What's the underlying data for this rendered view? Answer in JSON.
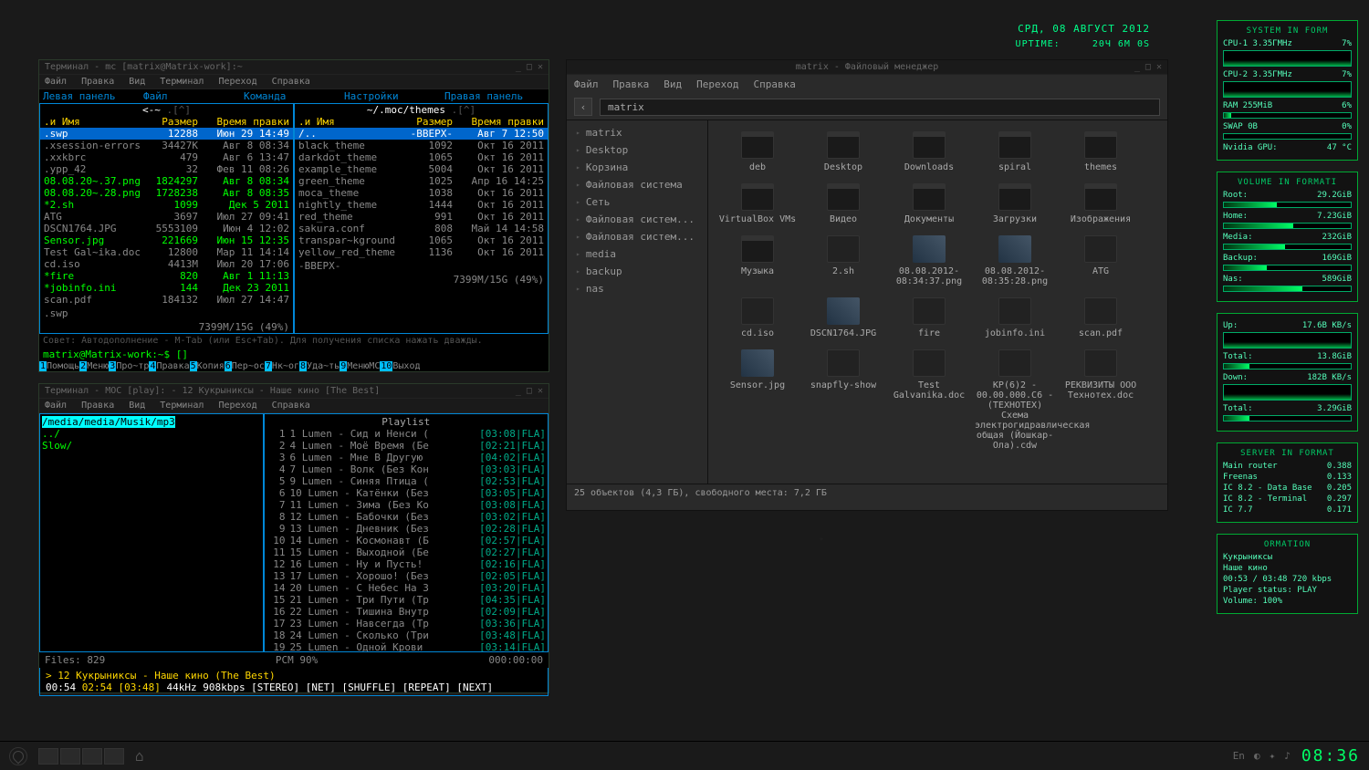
{
  "top_date": "СРД, 08 АВГУСТ 2012",
  "uptime_label": "UPTIME:",
  "uptime_value": "20Ч 6M 0S",
  "mc": {
    "title": "Терминал - mc [matrix@Matrix-work]:~",
    "menu": [
      "Файл",
      "Правка",
      "Вид",
      "Терминал",
      "Переход",
      "Справка"
    ],
    "head": [
      "Левая панель",
      "Файл",
      "Команда",
      "Настройки",
      "Правая панель"
    ],
    "left_title": "<-~",
    "right_title": "~/.moc/themes",
    "cols": {
      "name": ".и  Имя",
      "size": "Размер",
      "date": "Время правки"
    },
    "left_rows": [
      {
        "n": ".swp",
        "s": "12288",
        "d": "Июн 29 14:49",
        "cls": "sel"
      },
      {
        "n": ".xsession-errors",
        "s": "34427K",
        "d": "Авг  8 08:34",
        "cls": ""
      },
      {
        "n": ".xxkbrc",
        "s": "479",
        "d": "Авг  6 13:47",
        "cls": ""
      },
      {
        "n": ".ypp_42",
        "s": "32",
        "d": "Фев 11 08:26",
        "cls": ""
      },
      {
        "n": "08.08.20~.37.png",
        "s": "1824297",
        "d": "Авг  8 08:34",
        "cls": "exec"
      },
      {
        "n": "08.08.20~.28.png",
        "s": "1728238",
        "d": "Авг  8 08:35",
        "cls": "exec"
      },
      {
        "n": "*2.sh",
        "s": "1099",
        "d": "Дек  5  2011",
        "cls": "exec"
      },
      {
        "n": "ATG",
        "s": "3697",
        "d": "Июл 27 09:41",
        "cls": ""
      },
      {
        "n": "DSCN1764.JPG",
        "s": "5553109",
        "d": "Июн  4 12:02",
        "cls": ""
      },
      {
        "n": "Sensor.jpg",
        "s": "221669",
        "d": "Июн 15 12:35",
        "cls": "exec"
      },
      {
        "n": "Test Gal~ika.doc",
        "s": "12800",
        "d": "Мар 11 14:14",
        "cls": ""
      },
      {
        "n": "cd.iso",
        "s": "4413M",
        "d": "Июл 20 17:06",
        "cls": ""
      },
      {
        "n": "*fire",
        "s": "820",
        "d": "Авг  1 11:13",
        "cls": "exec"
      },
      {
        "n": "*jobinfo.ini",
        "s": "144",
        "d": "Дек 23  2011",
        "cls": "exec"
      },
      {
        "n": "scan.pdf",
        "s": "184132",
        "d": "Июл 27 14:47",
        "cls": ""
      }
    ],
    "right_rows": [
      {
        "n": "/..",
        "s": "-ВВЕРХ-",
        "d": "Авг  7 12:50",
        "cls": "sel"
      },
      {
        "n": "black_theme",
        "s": "1092",
        "d": "Окт 16  2011",
        "cls": ""
      },
      {
        "n": "darkdot_theme",
        "s": "1065",
        "d": "Окт 16  2011",
        "cls": ""
      },
      {
        "n": "example_theme",
        "s": "5004",
        "d": "Окт 16  2011",
        "cls": ""
      },
      {
        "n": "green_theme",
        "s": "1025",
        "d": "Апр 16 14:25",
        "cls": ""
      },
      {
        "n": "moca_theme",
        "s": "1038",
        "d": "Окт 16  2011",
        "cls": ""
      },
      {
        "n": "nightly_theme",
        "s": "1444",
        "d": "Окт 16  2011",
        "cls": ""
      },
      {
        "n": "red_theme",
        "s": "991",
        "d": "Окт 16  2011",
        "cls": ""
      },
      {
        "n": "sakura.conf",
        "s": "808",
        "d": "Май 14 14:58",
        "cls": ""
      },
      {
        "n": "transpar~kground",
        "s": "1065",
        "d": "Окт 16  2011",
        "cls": ""
      },
      {
        "n": "yellow_red_theme",
        "s": "1136",
        "d": "Окт 16  2011",
        "cls": ""
      }
    ],
    "left_sel": ".swp",
    "right_sel": "-ВВЕРХ-",
    "disk": "7399M/15G (49%)",
    "hint": "Совет: Автодополнение - M-Tab (или Esc+Tab). Для получения списка нажать дважды.",
    "prompt": "matrix@Matrix-work:~$ []",
    "fkeys": [
      {
        "k": "1",
        "l": "Помощь"
      },
      {
        "k": "2",
        "l": "Меню"
      },
      {
        "k": "3",
        "l": "Про~тр"
      },
      {
        "k": "4",
        "l": "Правка"
      },
      {
        "k": "5",
        "l": "Копия"
      },
      {
        "k": "6",
        "l": "Пер~ос"
      },
      {
        "k": "7",
        "l": "Нк~ог"
      },
      {
        "k": "8",
        "l": "Уда~ть"
      },
      {
        "k": "9",
        "l": "МенюМС"
      },
      {
        "k": "10",
        "l": "Выход"
      }
    ]
  },
  "moc": {
    "title": "Терминал - MOC [play]: - 12 Кукрыниксы - Наше кино [The Best]",
    "menu": [
      "Файл",
      "Правка",
      "Вид",
      "Терминал",
      "Переход",
      "Справка"
    ],
    "path": "/media/media/Musik/mp3",
    "dirs": [
      "../",
      "Slow/"
    ],
    "playlist_title": "Playlist",
    "tracks": [
      {
        "i": "1",
        "n": "1 Lumen - Сид и Ненси (",
        "d": "[03:08|FLA]"
      },
      {
        "i": "2",
        "n": "4 Lumen - Моё Время (Бе",
        "d": "[02:21|FLA]"
      },
      {
        "i": "3",
        "n": "6 Lumen - Мне В Другую ",
        "d": "[04:02|FLA]"
      },
      {
        "i": "4",
        "n": "7 Lumen - Волк (Без Кон",
        "d": "[03:03|FLA]"
      },
      {
        "i": "5",
        "n": "9 Lumen - Синяя Птица (",
        "d": "[02:53|FLA]"
      },
      {
        "i": "6",
        "n": "10 Lumen - Катёнки (Без",
        "d": "[03:05|FLA]"
      },
      {
        "i": "7",
        "n": "11 Lumen - Зима (Без Ко",
        "d": "[03:08|FLA]"
      },
      {
        "i": "8",
        "n": "12 Lumen - Бабочки (Без",
        "d": "[03:02|FLA]"
      },
      {
        "i": "9",
        "n": "13 Lumen - Дневник (Без",
        "d": "[02:28|FLA]"
      },
      {
        "i": "10",
        "n": "14 Lumen - Космонавт (Б",
        "d": "[02:57|FLA]"
      },
      {
        "i": "11",
        "n": "15 Lumen - Выходной (Бе",
        "d": "[02:27|FLA]"
      },
      {
        "i": "12",
        "n": "16 Lumen - Ну и Пусть! ",
        "d": "[02:16|FLA]"
      },
      {
        "i": "13",
        "n": "17 Lumen - Хорошо! (Без",
        "d": "[02:05|FLA]"
      },
      {
        "i": "14",
        "n": "20 Lumen - С Небес На З",
        "d": "[03:20|FLA]"
      },
      {
        "i": "15",
        "n": "21 Lumen - Три Пути (Тр",
        "d": "[04:35|FLA]"
      },
      {
        "i": "16",
        "n": "22 Lumen - Тишина Внутр",
        "d": "[02:09|FLA]"
      },
      {
        "i": "17",
        "n": "23 Lumen - Навсегда (Тр",
        "d": "[03:36|FLA]"
      },
      {
        "i": "18",
        "n": "24 Lumen - Сколько (Три",
        "d": "[03:48|FLA]"
      },
      {
        "i": "19",
        "n": "25 Lumen - Одной Крови ",
        "d": "[03:14|FLA]"
      }
    ],
    "files": "Files: 829",
    "pcm": "PCM   90%",
    "total": "000:00:00",
    "playing": "> 12 Кукрыниксы - Наше кино (The Best)",
    "time": "00:54",
    "elapsed": "02:54 [03:48]",
    "info": "  44kHz  908kbps [STEREO] [NET] [SHUFFLE] [REPEAT] [NEXT]"
  },
  "thunar": {
    "title": "matrix - Файловый менеджер",
    "menu": [
      "Файл",
      "Правка",
      "Вид",
      "Переход",
      "Справка"
    ],
    "path": "matrix",
    "side": [
      "matrix",
      "Desktop",
      "Корзина",
      "Файловая система",
      "Сеть",
      "Файловая систем...",
      "Файловая систем...",
      "media",
      "backup",
      "nas"
    ],
    "icons": [
      {
        "n": "deb",
        "t": "folder"
      },
      {
        "n": "Desktop",
        "t": "folder"
      },
      {
        "n": "Downloads",
        "t": "folder"
      },
      {
        "n": "spiral",
        "t": "folder"
      },
      {
        "n": "themes",
        "t": "folder"
      },
      {
        "n": "VirtualBox VMs",
        "t": "folder"
      },
      {
        "n": "Видео",
        "t": "folder"
      },
      {
        "n": "Документы",
        "t": "folder"
      },
      {
        "n": "Загрузки",
        "t": "folder"
      },
      {
        "n": "Изображения",
        "t": "folder"
      },
      {
        "n": "Музыка",
        "t": "folder"
      },
      {
        "n": "2.sh",
        "t": "file"
      },
      {
        "n": "08.08.2012-08:34:37.png",
        "t": "img"
      },
      {
        "n": "08.08.2012-08:35:28.png",
        "t": "img"
      },
      {
        "n": "ATG",
        "t": "file"
      },
      {
        "n": "cd.iso",
        "t": "file"
      },
      {
        "n": "DSCN1764.JPG",
        "t": "img"
      },
      {
        "n": "fire",
        "t": "file"
      },
      {
        "n": "jobinfo.ini",
        "t": "file"
      },
      {
        "n": "scan.pdf",
        "t": "file"
      },
      {
        "n": "Sensor.jpg",
        "t": "img"
      },
      {
        "n": "snapfly-show",
        "t": "file"
      },
      {
        "n": "Test Galvanika.doc",
        "t": "file"
      },
      {
        "n": "КР(6)2 - 00.00.000.С6 - (ТЕХНОТЕХ) Схема электрогидравлическая общая (Йошкар-Ола).cdw",
        "t": "file"
      },
      {
        "n": "РЕКВИЗИТЫ ООО Технотех.doc",
        "t": "file"
      }
    ],
    "status": "25 объектов (4,3 ГБ), свободного места: 7,2 ГБ"
  },
  "conky": {
    "sys_title": "SYSTEM IN FORM",
    "cpu1": {
      "l": "CPU-1 3.35ГMHz",
      "v": "7%"
    },
    "cpu2": {
      "l": "CPU-2 3.35ГMHz",
      "v": "7%"
    },
    "ram": {
      "l": "RAM 255MiB",
      "v": "6%"
    },
    "swap": {
      "l": "SWAP 0B",
      "v": "0%"
    },
    "gpu": {
      "l": "Nvidia GPU:",
      "v": "47 °C"
    },
    "vol_title": "VOLUME IN FORMATI",
    "vols": [
      {
        "l": "Root:",
        "v": "29.2GiB"
      },
      {
        "l": "Home:",
        "v": "7.23GiB"
      },
      {
        "l": "Media:",
        "v": "232GiB"
      },
      {
        "l": "Backup:",
        "v": "169GiB"
      },
      {
        "l": "Nas:",
        "v": "589GiB"
      }
    ],
    "net_rows": [
      {
        "l": "Up:",
        "v": "17.6B  KB/s"
      },
      {
        "l": "Total:",
        "v": "13.8GiB"
      },
      {
        "l": "Down:",
        "v": "182B  KB/s"
      },
      {
        "l": "Total:",
        "v": "3.29GiB"
      }
    ],
    "srv_title": "SERVER IN FORMAT",
    "srv": [
      {
        "l": "Main router",
        "v": "0.388"
      },
      {
        "l": "Freenas",
        "v": "0.133"
      },
      {
        "l": "IC 8.2 - Data Base",
        "v": "0.205"
      },
      {
        "l": "IC 8.2 - Terminal",
        "v": "0.297"
      },
      {
        "l": "IC 7.7",
        "v": "0.171"
      }
    ],
    "orm_title": "ORMATION",
    "orm": [
      "Кукрыниксы",
      "Наше кино",
      "00:53 / 03:48 720 kbps",
      "Player status: PLAY",
      "Volume: 100%"
    ]
  },
  "taskbar": {
    "lang": "En",
    "clock": "08:36"
  }
}
